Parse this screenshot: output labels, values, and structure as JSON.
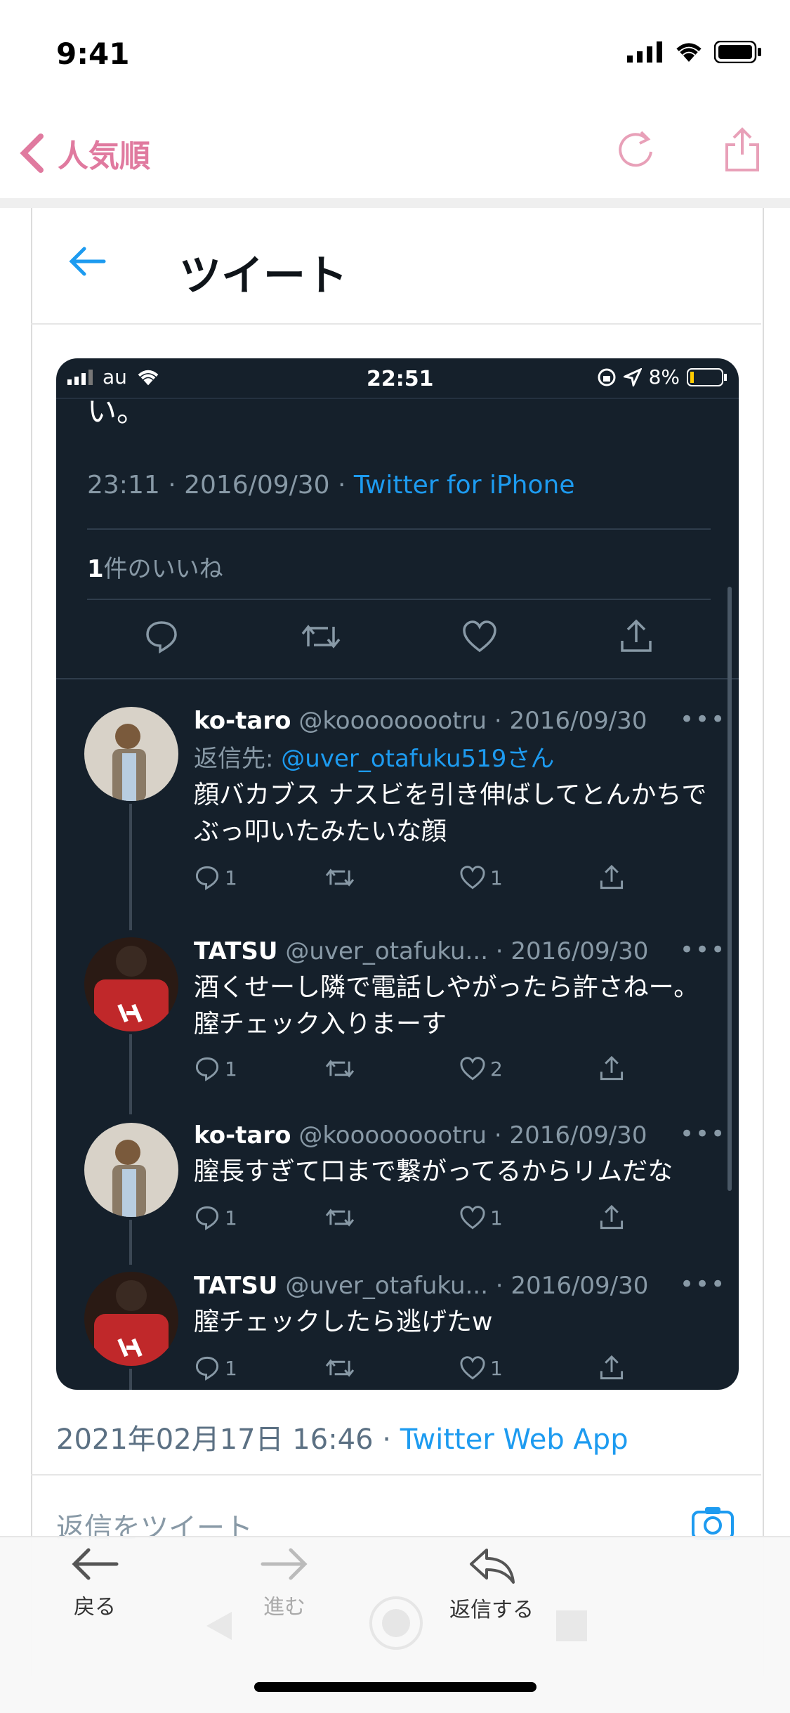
{
  "status_bar": {
    "time": "9:41"
  },
  "nav": {
    "back_label": "人気順"
  },
  "tweet_header": {
    "title": "ツイート"
  },
  "embedded": {
    "status": {
      "carrier": "au",
      "time": "22:51",
      "battery": "8%"
    },
    "truncated_text": "い。",
    "meta_time": "23:11 · 2016/09/30 · ",
    "meta_source": "Twitter for iPhone",
    "likes_count": "1",
    "likes_label": "件のいいね",
    "replies": [
      {
        "name": "ko-taro",
        "handle": "@kooooooootru · 2016/09/30",
        "reply_to_label": "返信先: ",
        "reply_to_handle": "@uver_otafuku519さん",
        "text": "顔バカブス ナスビを引き伸ばしてとんかちでぶっ叩いたみたいな顔",
        "reply_count": "1",
        "like_count": "1"
      },
      {
        "name": "TATSU",
        "handle": "@uver_otafuku... · 2016/09/30",
        "text": "酒くせーし隣で電話しやがったら許さねー。膣チェック入りまーす",
        "reply_count": "1",
        "like_count": "2"
      },
      {
        "name": "ko-taro",
        "handle": "@kooooooootru · 2016/09/30",
        "text": "膣長すぎて口まで繋がってるからリムだな",
        "reply_count": "1",
        "like_count": "1"
      },
      {
        "name": "TATSU",
        "handle": "@uver_otafuku... · 2016/09/30",
        "text": "膣チェックしたら逃げたw",
        "reply_count": "1",
        "like_count": "1"
      }
    ],
    "dots": "•••"
  },
  "posted": {
    "date": "2021年02月17日 16:46 · ",
    "source": "Twitter Web App"
  },
  "reply_placeholder": "返信をツイート",
  "toolbar": {
    "back": "戻る",
    "forward": "進む",
    "reply": "返信する"
  },
  "colors": {
    "accent_pink": "#e07a9f",
    "twitter_blue": "#1d9bf0",
    "dark_bg": "#15202b"
  }
}
